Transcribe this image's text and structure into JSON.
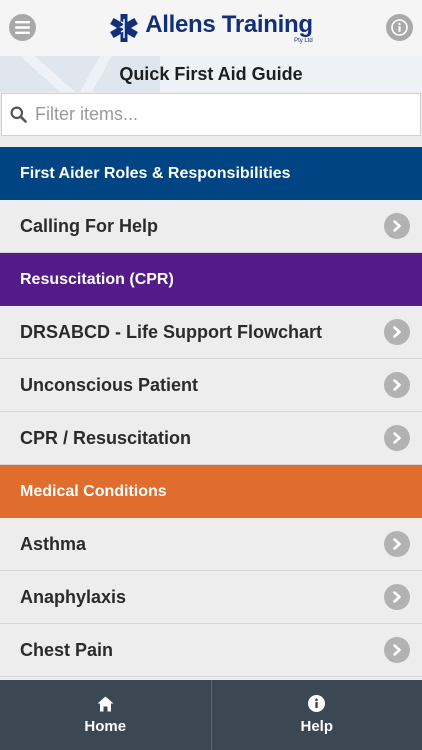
{
  "header": {
    "logo_title": "Allens Training",
    "logo_sub": "Pty Ltd",
    "menu_icon": "hamburger-icon",
    "info_icon": "info-icon"
  },
  "page_title": "Quick First Aid Guide",
  "search": {
    "placeholder": "Filter items...",
    "value": ""
  },
  "colors": {
    "roles": "#004483",
    "cpr": "#541a87",
    "medical": "#e06c2e"
  },
  "list": [
    {
      "type": "section",
      "label": "First Aider Roles & Responsibilities",
      "color": "#004483"
    },
    {
      "type": "item",
      "label": "Calling For Help"
    },
    {
      "type": "section",
      "label": "Resuscitation (CPR)",
      "color": "#541a87"
    },
    {
      "type": "item",
      "label": "DRSABCD - Life Support Flowchart"
    },
    {
      "type": "item",
      "label": "Unconscious Patient"
    },
    {
      "type": "item",
      "label": "CPR / Resuscitation"
    },
    {
      "type": "section",
      "label": "Medical Conditions",
      "color": "#e06c2e"
    },
    {
      "type": "item",
      "label": "Asthma"
    },
    {
      "type": "item",
      "label": "Anaphylaxis"
    },
    {
      "type": "item",
      "label": "Chest Pain"
    }
  ],
  "nav": {
    "home_label": "Home",
    "help_label": "Help"
  }
}
